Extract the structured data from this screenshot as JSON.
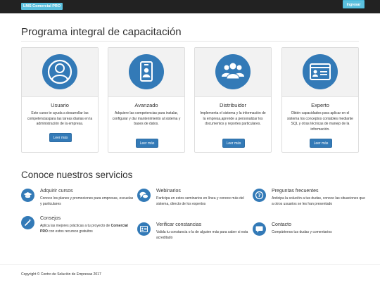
{
  "navbar": {
    "brand": "LMS Comercial PRO",
    "login_label": "Ingresar"
  },
  "hero": {
    "title": "Programa integral de capacitación"
  },
  "cards": [
    {
      "icon": "user-icon",
      "title": "Usuario",
      "text": "Este curso te ayuda a desarrollar las competenciaspara las tareas diarias en la administración de la empresa.",
      "button": "Leer más"
    },
    {
      "icon": "id-badge-icon",
      "title": "Avanzado",
      "text": "Adquiere las competencias para instalar, configurar y dar mantenimiento al sistema y bases de datos.",
      "button": "Leer más"
    },
    {
      "icon": "group-icon",
      "title": "Distribuidor",
      "text": "Implementa el sistema y la información de la empresa,aprende a personalizar los documentos y reportes particulares.",
      "button": "Leer más"
    },
    {
      "icon": "id-card-icon",
      "title": "Experto",
      "text": "Obtén capacidades para aplicar en el sistema los conceptos contables mediante SQL y otras técnicas de manejo de la información.",
      "button": "Leer más"
    }
  ],
  "services": {
    "title": "Conoce nuestros servicios",
    "items": [
      {
        "icon": "graduation-cap-icon",
        "title": "Adquirir cursos",
        "text": "Conoce los planes y promociones para empresas, escuelas y particulares"
      },
      {
        "icon": "chat-bubbles-icon",
        "title": "Webinarios",
        "text": "Participa en estos seminarios en línea y conoce más del sistema, directo de los expertos"
      },
      {
        "icon": "question-icon",
        "title": "Preguntas frecuentes",
        "text": "Anticipa la solución a tus dudas, conoce las situaciones que a otros usuarios se les han presentado"
      },
      {
        "icon": "magic-wand-icon",
        "title": "Consejos",
        "text_prefix": "Aplica las mejores prácticas a tu proyecto de ",
        "text_bold": "Comercial PRO",
        "text_suffix": " con estos recursos gratuitos"
      },
      {
        "icon": "id-card-icon",
        "title": "Verificar constancias",
        "text": "Valida tu constancia o la de alguien más para saber si esta acreditado"
      },
      {
        "icon": "comment-icon",
        "title": "Contacto",
        "text": "Compártenos tus dudas y comentarios"
      }
    ]
  },
  "footer": {
    "text": "Copyright © Centro de Solución de Empresas 2017"
  },
  "colors": {
    "primary": "#337ab7",
    "info": "#5bc0de",
    "navbar": "#222222"
  }
}
